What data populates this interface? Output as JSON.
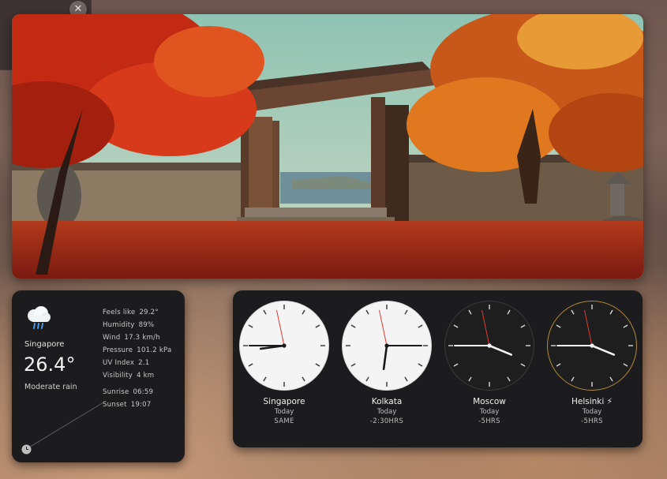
{
  "weather": {
    "city": "Singapore",
    "temperature": "26.4°",
    "condition": "Moderate rain",
    "icon": "rain-cloud-icon",
    "details": [
      {
        "label": "Feels like",
        "value": "29.2°"
      },
      {
        "label": "Humidity",
        "value": "89%"
      },
      {
        "label": "Wind",
        "value": "17.3 km/h"
      },
      {
        "label": "Pressure",
        "value": "101.2 kPa"
      },
      {
        "label": "UV Index",
        "value": "2.1"
      },
      {
        "label": "Visibility",
        "value": "4 km"
      }
    ],
    "sunrise": {
      "label": "Sunrise",
      "value": "06:59"
    },
    "sunset": {
      "label": "Sunset",
      "value": "19:07"
    }
  },
  "world_clock": {
    "clocks": [
      {
        "city": "Singapore",
        "day": "Today",
        "offset": "SAME",
        "theme": "light",
        "hour": 8,
        "minute": 45,
        "second": 58
      },
      {
        "city": "Kolkata",
        "day": "Today",
        "offset": "-2:30HRS",
        "theme": "light",
        "hour": 6,
        "minute": 15,
        "second": 58
      },
      {
        "city": "Moscow",
        "day": "Today",
        "offset": "-5HRS",
        "theme": "dark",
        "hour": 3,
        "minute": 45,
        "second": 58
      },
      {
        "city": "Helsinki ⚡",
        "day": "Today",
        "offset": "-5HRS",
        "theme": "dark-gold",
        "hour": 3,
        "minute": 45,
        "second": 58
      }
    ]
  },
  "close_button": {
    "label": "✕"
  },
  "colors": {
    "widget_bg": "#1c1c1e",
    "second_hand": "#e03a2f",
    "gold_ring": "#b08a3a"
  }
}
